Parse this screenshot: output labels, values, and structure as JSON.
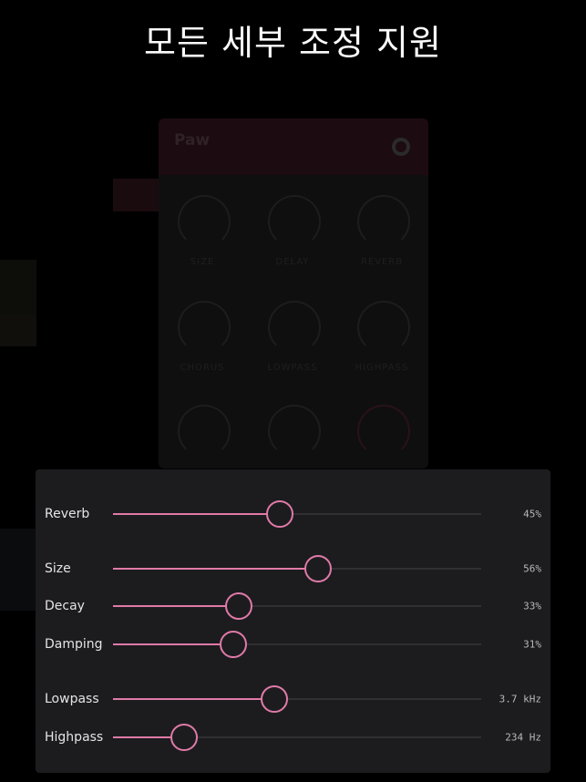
{
  "headline": "모든 세부 조정 지원",
  "plugin": {
    "title": "Paw",
    "knobs": [
      "SIZE",
      "DELAY",
      "REVERB",
      "CHORUS",
      "LOWPASS",
      "HIGHPASS"
    ]
  },
  "accent_color": "#e07aa8",
  "sliders": [
    {
      "label": "Reverb",
      "value": "45%",
      "fraction": 0.45
    },
    {
      "label": "Size",
      "value": "56%",
      "fraction": 0.555
    },
    {
      "label": "Decay",
      "value": "33%",
      "fraction": 0.34
    },
    {
      "label": "Damping",
      "value": "31%",
      "fraction": 0.325
    },
    {
      "label": "Lowpass",
      "value": "3.7 kHz",
      "fraction": 0.435
    },
    {
      "label": "Highpass",
      "value": "234 Hz",
      "fraction": 0.19
    }
  ]
}
